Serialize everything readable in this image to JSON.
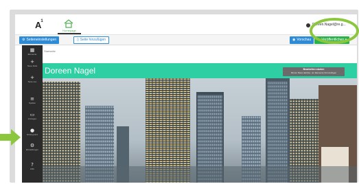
{
  "header": {
    "logo": "A",
    "logo_sup": "1",
    "home_label": "Homepage",
    "user_name": "Doreen.Nagel@re.g...",
    "user_caret": "▾"
  },
  "toolbar": {
    "page_settings": "Seiteneinstellungen",
    "add_page": "Seite hinzufügen",
    "preview": "Vorschau",
    "publish": "Veröffentlichen"
  },
  "sidebar": {
    "items": [
      {
        "icon": "▦",
        "label": "Elemente"
      },
      {
        "icon": "+",
        "label": "Neue Zeile"
      },
      {
        "icon": "+",
        "label": "Seite neu"
      },
      {
        "icon": "≡",
        "label": "Spalten"
      },
      {
        "icon": "▭",
        "label": "Anzeigen"
      },
      {
        "icon": "●",
        "label": "Hintergrund"
      },
      {
        "icon": "⚙",
        "label": "Einstellungen"
      },
      {
        "icon": "?",
        "label": "Hilfe"
      }
    ]
  },
  "content": {
    "breadcrumb": "Startseite",
    "page_name": "Doreen Nagel",
    "tooltip_title": "Bearbeiten starten",
    "tooltip_text": "Mit der Maus darüber, um Elemente hinzuzufügen"
  },
  "colors": {
    "teal": "#2fcfa4",
    "blue": "#2e8bd6",
    "green": "#2db14b",
    "annotation_green": "#8cc63f",
    "sidebar": "#2b2b2b"
  }
}
